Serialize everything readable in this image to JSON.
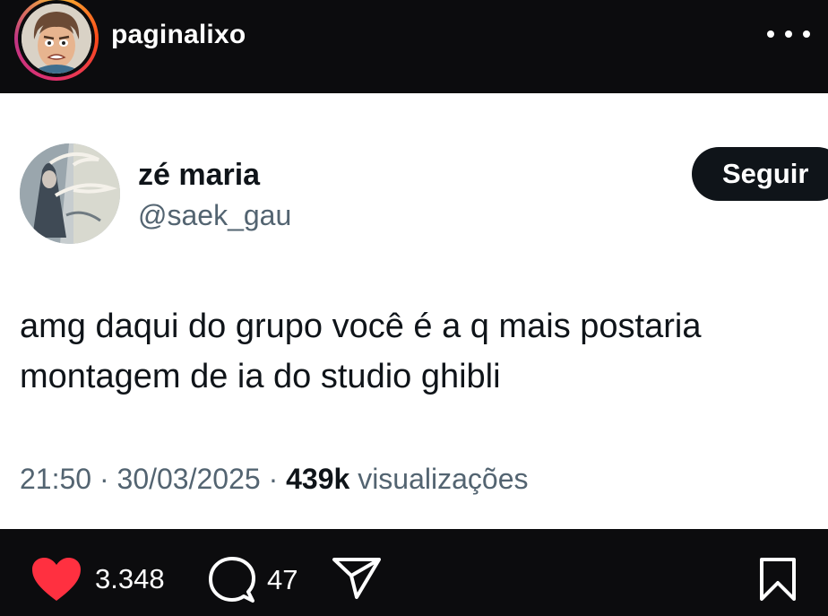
{
  "post": {
    "username": "paginalixo",
    "more_icon": "more-horizontal-icon"
  },
  "tweet": {
    "display_name": "zé maria",
    "handle": "@saek_gau",
    "follow_label": "Seguir",
    "text_lines": [
      "amg daqui do grupo você é a q mais postaria",
      "montagem de ia do studio ghibli"
    ],
    "time": "21:50",
    "separator": "·",
    "date": "30/03/2025",
    "views_count": "439k",
    "views_label": "visualizações"
  },
  "actions": {
    "likes": "3.348",
    "comments": "47",
    "like_color": "#ff3040",
    "icons": [
      "heart-icon",
      "comment-icon",
      "share-icon",
      "bookmark-icon"
    ]
  }
}
